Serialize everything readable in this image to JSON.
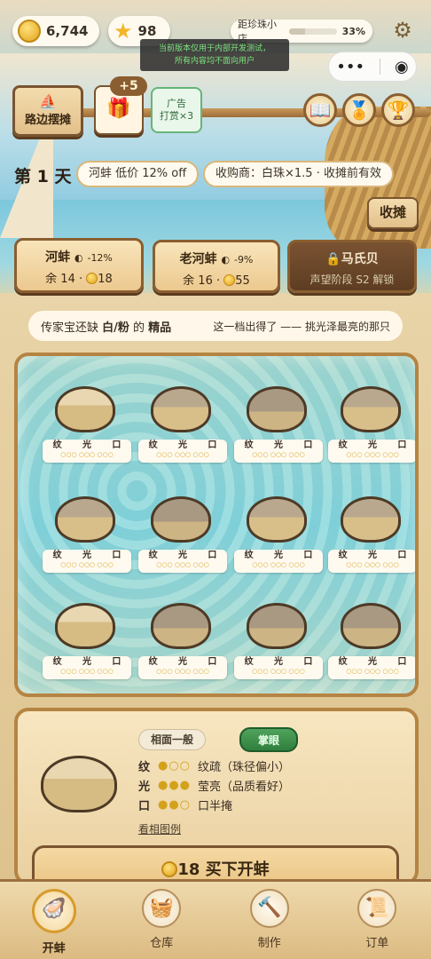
{
  "topbar": {
    "coins": "6,744",
    "stars": "98",
    "shop_label": "距珍珠小店",
    "shop_progress_text": "33%",
    "shop_progress": 0.33
  },
  "notice": {
    "line1": "当前版本仅用于内部开发测试，",
    "line2": "所有内容均不面向用户"
  },
  "toolbar": {
    "stall": "路边摆摊",
    "plus": "+5",
    "ad_line1": "广告",
    "ad_line2": "打赏×3"
  },
  "day": {
    "label": "第 1 天",
    "tag1": "河蚌 低价 12% off",
    "tag2": "收购商：白珠×1.5 · 收摊前有效",
    "close_stall": "收摊"
  },
  "cards": [
    {
      "name": "河蚌",
      "change": "-12%",
      "stock": "余 14",
      "price": "18"
    },
    {
      "name": "老河蚌",
      "change": "-9%",
      "stock": "余 16",
      "price": "55"
    },
    {
      "name": "马氏贝",
      "locked": "声望阶段 S2 解锁"
    }
  ],
  "hint": {
    "pre": "传家宝还缺 ",
    "color": "白/粉",
    "mid": " 的 ",
    "grade": "精品",
    "tail": "这一档出得了 —— 挑光泽最亮的那只"
  },
  "attr_labels": [
    "纹",
    "光",
    "口"
  ],
  "clams": [
    {
      "shell": "c"
    },
    {
      "shell": "a"
    },
    {
      "shell": "b"
    },
    {
      "shell": "a"
    },
    {
      "shell": "a"
    },
    {
      "shell": "b"
    },
    {
      "shell": "a"
    },
    {
      "shell": "a"
    },
    {
      "shell": "c"
    },
    {
      "shell": "b"
    },
    {
      "shell": "b"
    },
    {
      "shell": "b"
    }
  ],
  "detail": {
    "tab1": "相面一般",
    "tab2": "掌眼",
    "rows": [
      {
        "k": "纹",
        "dots": "●○○",
        "v": "纹疏（珠径偏小）"
      },
      {
        "k": "光",
        "dots": "●●●",
        "v": "莹亮（品质看好）"
      },
      {
        "k": "口",
        "dots": "●●○",
        "v": "口半掩"
      }
    ],
    "link": "看相图例"
  },
  "buy": {
    "price": "18",
    "label": "买下开蚌"
  },
  "nav": [
    {
      "label": "开蚌",
      "icon": "🦪"
    },
    {
      "label": "仓库",
      "icon": "🧺"
    },
    {
      "label": "制作",
      "icon": "🔨"
    },
    {
      "label": "订单",
      "icon": "📜"
    }
  ],
  "colors": {
    "wood_dark": "#7a5430",
    "accent_green": "#3f8f4a",
    "gold": "#d3a11c"
  }
}
